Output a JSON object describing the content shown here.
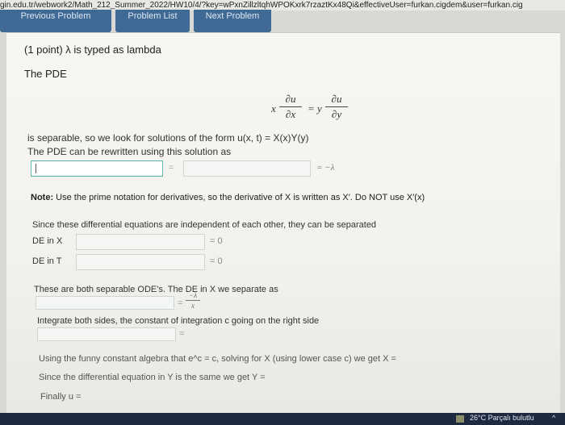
{
  "browser": {
    "url": "gin.edu.tr/webwork2/Math_212_Summer_2022/HW10/4/?key=wPxnZillzltqhWPOKxrk7rzaztKx48Qi&effectiveUser=furkan.cigdem&user=furkan.cig"
  },
  "nav": {
    "prev": "Previous Problem",
    "list": "Problem List",
    "next": "Next Problem"
  },
  "problem": {
    "points": "(1 point) λ is typed as lambda",
    "intro": "The PDE",
    "pde_x": "x",
    "pde_du": "∂u",
    "pde_dx": "∂x",
    "pde_eq": "= y",
    "pde_dy": "∂y",
    "separable": "is separable, so we look for solutions of the form u(x, t) = X(x)Y(y)",
    "rewritten": "The PDE can be rewritten using this solution as",
    "eq_sign": "=",
    "eq_lambda": "= −λ",
    "note_label": "Note:",
    "note_text": " Use the prime notation for derivatives, so the derivative of X is written as X′. Do NOT use X′(x)",
    "since": "Since these differential equations are independent of each other, they can be separated",
    "de_x_label": "DE in X",
    "de_x_eq": "= 0",
    "de_t_label": "DE in T",
    "de_t_eq": "= 0",
    "separable_odes": "These are both separable ODE's. The DE in X we separate as",
    "sep_eq": "=",
    "sep_num": "−λ",
    "sep_den": "x",
    "integrate": "Integrate both sides, the constant of integration c going on the right side",
    "int_eq": "=",
    "funny": "Using the funny constant algebra that e^c = c, solving for X (using lower case c) we get X =",
    "since_y": "Since the differential equation in Y is the same we get Y =",
    "finally": "Finally u ="
  },
  "taskbar": {
    "weather": "26°C  Parçalı bulutlu"
  }
}
